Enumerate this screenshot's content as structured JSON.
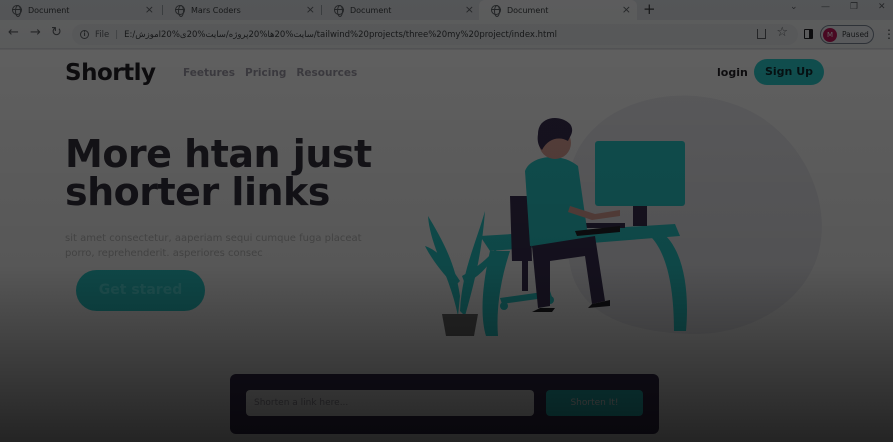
{
  "browser": {
    "tabs": [
      {
        "title": "Document",
        "active": false
      },
      {
        "title": "Mars Coders",
        "active": false
      },
      {
        "title": "Document",
        "active": false
      },
      {
        "title": "Document",
        "active": true
      }
    ],
    "new_tab_label": "+",
    "address": {
      "scheme": "File",
      "url": "E:/سایت%20ها%20پروژه/سایت%20ی%20آموزش/tailwind%20projects/three%20my%20project/index.html"
    },
    "profile": {
      "initial": "M",
      "status": "Paused"
    }
  },
  "page": {
    "brand": "Shortly",
    "nav": [
      "Feetures",
      "Pricing",
      "Resources"
    ],
    "login": "login",
    "signup": "Sign Up",
    "hero": {
      "line1": "More htan just",
      "line2": "shorter links",
      "text": "sit amet consectetur, aaperiam sequi cumque fuga placeat porro, reprehenderit. asperiores consec",
      "cta": "Get stared"
    },
    "shorten": {
      "placeholder": "Shorten a link here...",
      "button": "Shorten It!"
    }
  },
  "colors": {
    "cyan": "#2acfcf",
    "dark_violet": "#3b3054",
    "heading": "#34313d",
    "overlay": "rgba(0,0,0,0.65)"
  }
}
